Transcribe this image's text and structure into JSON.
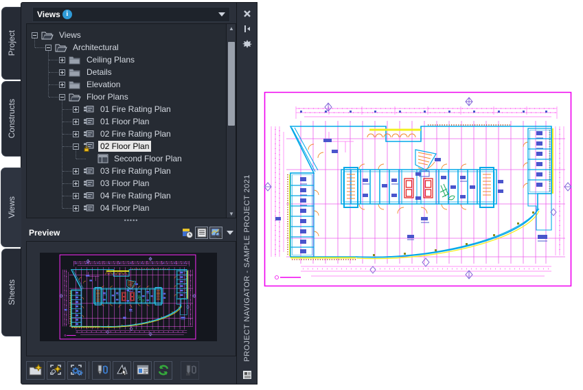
{
  "palette": {
    "tabs": [
      {
        "label": "Project",
        "active": false
      },
      {
        "label": "Constructs",
        "active": false
      },
      {
        "label": "Views",
        "active": true
      },
      {
        "label": "Sheets",
        "active": false
      }
    ],
    "header": {
      "title": "Views"
    },
    "tree": {
      "rows": [
        {
          "label": "Views",
          "level": 0,
          "expand": "minus",
          "icon": "folder-open",
          "selected": false
        },
        {
          "label": "Architectural",
          "level": 1,
          "expand": "minus",
          "icon": "folder-open",
          "selected": false
        },
        {
          "label": "Ceiling Plans",
          "level": 2,
          "expand": "plus",
          "icon": "folder-closed",
          "selected": false
        },
        {
          "label": "Details",
          "level": 2,
          "expand": "plus",
          "icon": "folder-closed",
          "selected": false
        },
        {
          "label": "Elevation",
          "level": 2,
          "expand": "plus",
          "icon": "folder-closed",
          "selected": false
        },
        {
          "label": "Floor Plans",
          "level": 2,
          "expand": "minus",
          "icon": "folder-open",
          "selected": false
        },
        {
          "label": "01 Fire Rating Plan",
          "level": 3,
          "expand": "plus",
          "icon": "view",
          "selected": false
        },
        {
          "label": "01 Floor Plan",
          "level": 3,
          "expand": "plus",
          "icon": "view",
          "selected": false
        },
        {
          "label": "02 Fire Rating Plan",
          "level": 3,
          "expand": "plus",
          "icon": "view",
          "selected": false
        },
        {
          "label": "02 Floor Plan",
          "level": 3,
          "expand": "minus",
          "icon": "view-locked",
          "selected": true
        },
        {
          "label": "Second Floor Plan",
          "level": 4,
          "expand": "",
          "icon": "viewport",
          "selected": false
        },
        {
          "label": "03 Fire Rating Plan",
          "level": 3,
          "expand": "plus",
          "icon": "view",
          "selected": false
        },
        {
          "label": "03 Floor Plan",
          "level": 3,
          "expand": "plus",
          "icon": "view",
          "selected": false
        },
        {
          "label": "04 Fire Rating Plan",
          "level": 3,
          "expand": "plus",
          "icon": "view",
          "selected": false
        },
        {
          "label": "04 Floor Plan",
          "level": 3,
          "expand": "plus",
          "icon": "view",
          "selected": false
        }
      ]
    },
    "preview": {
      "title": "Preview",
      "icons": [
        "details-time-icon",
        "list-view-icon",
        "image-preview-icon",
        "chevron-down-icon"
      ]
    },
    "toolbar": {
      "buttons": [
        {
          "icon": "new-category",
          "disabled": false
        },
        {
          "icon": "new-view",
          "disabled": false
        },
        {
          "icon": "new-model-view",
          "disabled": false
        },
        {
          "icon": "separator",
          "disabled": false
        },
        {
          "icon": "attach",
          "disabled": false
        },
        {
          "icon": "etransmit",
          "disabled": false
        },
        {
          "icon": "details",
          "disabled": false
        },
        {
          "icon": "refresh",
          "disabled": false
        },
        {
          "icon": "gap",
          "disabled": false
        },
        {
          "icon": "attach2",
          "disabled": true
        }
      ]
    },
    "sidebar": {
      "vertical_title": "PROJECT NAVIGATOR - SAMPLE PROJECT 2021",
      "icons": [
        "close-icon",
        "auto-hide-icon",
        "properties-icon"
      ]
    }
  }
}
